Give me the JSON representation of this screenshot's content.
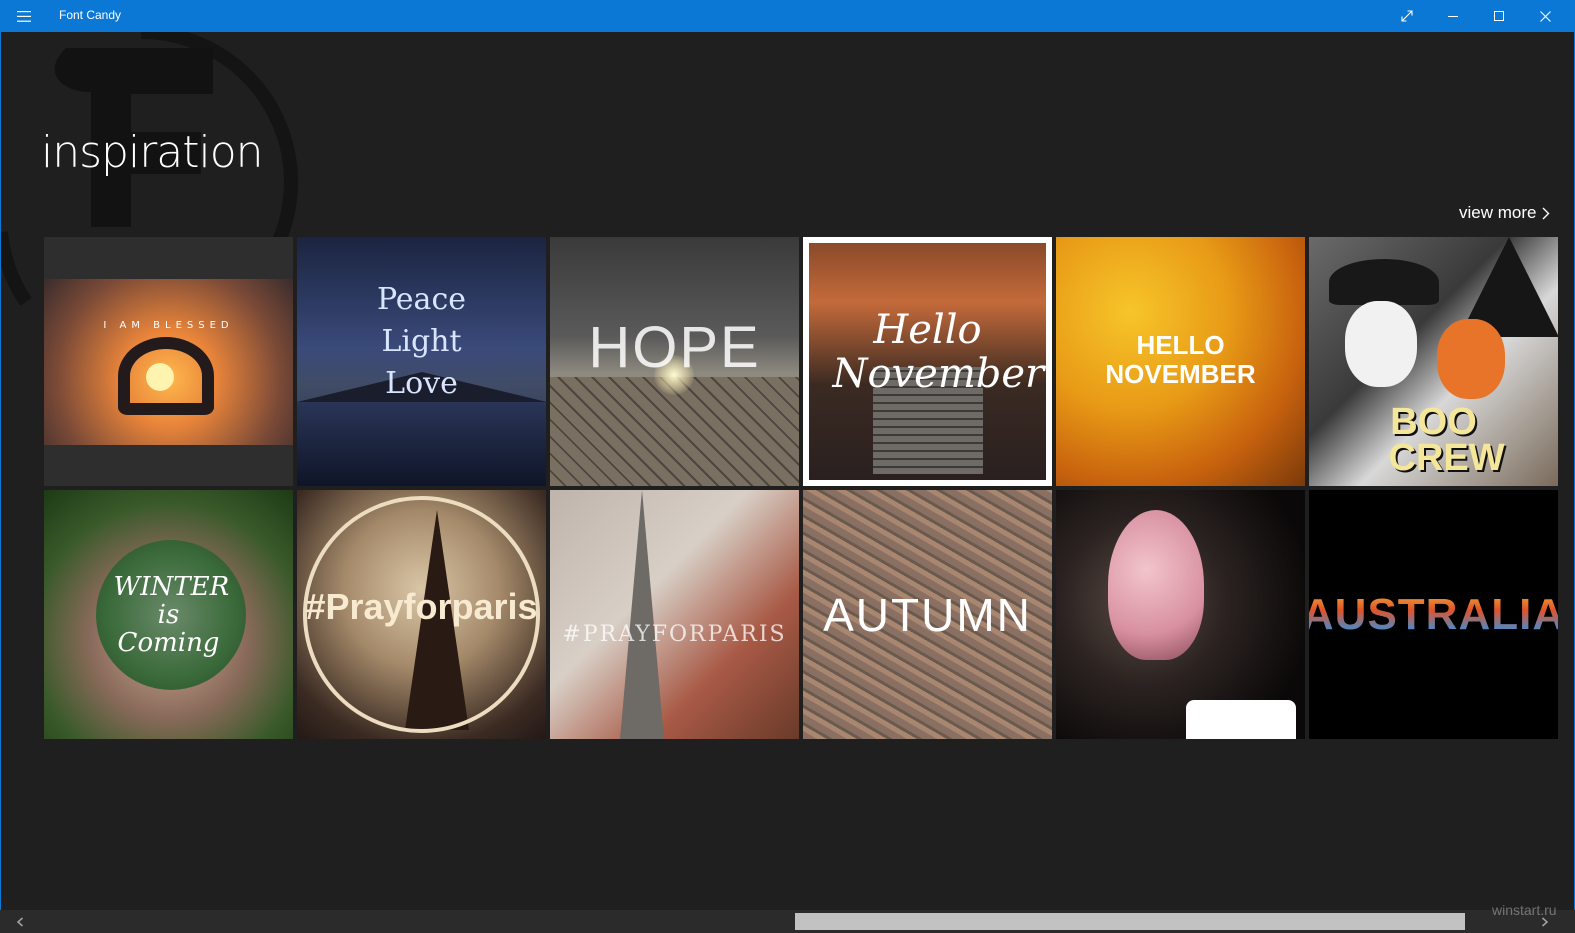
{
  "window": {
    "title": "Font Candy",
    "accent_color": "#0a78d4",
    "background_color": "#1f1f1f"
  },
  "page": {
    "title": "inspiration",
    "view_more_label": "view more"
  },
  "tiles": [
    {
      "caption": "I AM BLESSED"
    },
    {
      "caption": "Peace Light Love"
    },
    {
      "caption": "HOPE"
    },
    {
      "caption": "Hello November",
      "selected": true
    },
    {
      "caption": "HELLO NOVEMBER"
    },
    {
      "caption": "BOO CREW"
    },
    {
      "caption": "WINTER is Coming"
    },
    {
      "caption": "#Prayforparis"
    },
    {
      "caption": "#PRAYFORPARIS"
    },
    {
      "caption": "AUTUMN"
    },
    {
      "caption": ""
    },
    {
      "caption": "AUSTRALIA"
    }
  ],
  "watermark": "winstart.ru",
  "icons": {
    "menu": "hamburger-icon",
    "fullscreen": "expand-icon",
    "minimize": "minimize-icon",
    "maximize": "maximize-icon",
    "close": "close-icon",
    "view_more": "chevron-right-icon",
    "scroll_left": "chevron-left-icon",
    "scroll_right": "chevron-right-icon"
  }
}
